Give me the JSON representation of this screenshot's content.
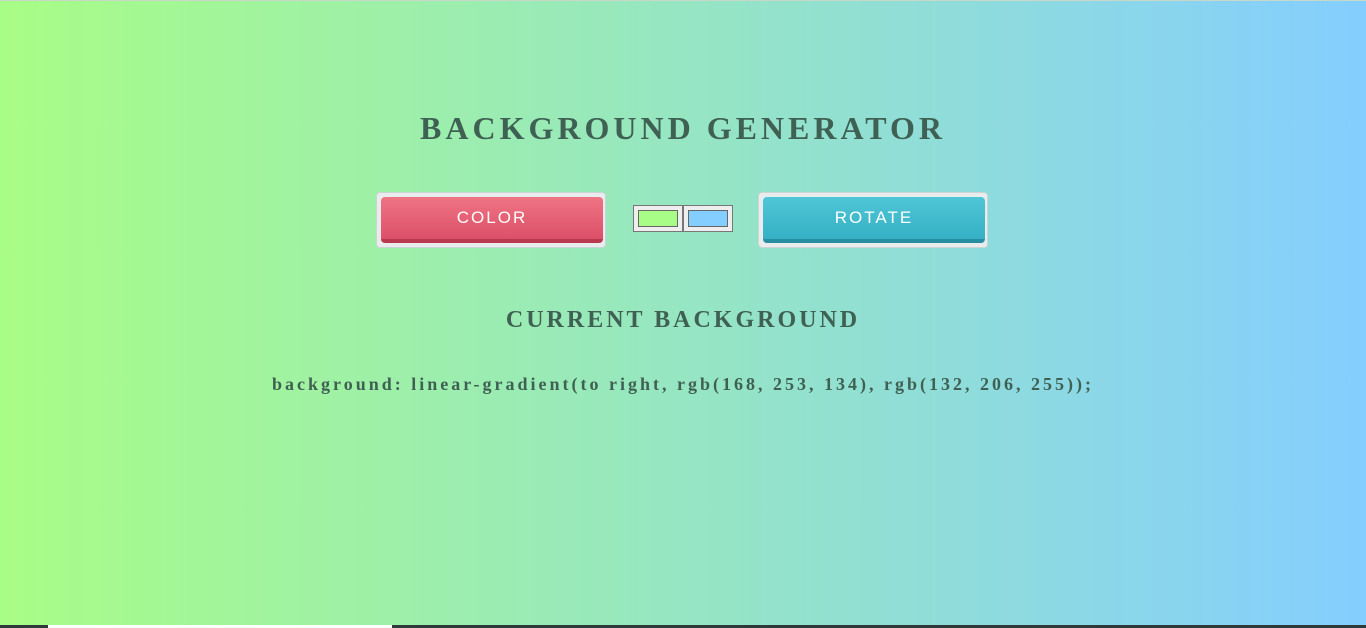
{
  "page": {
    "title": "BACKGROUND GENERATOR",
    "subtitle": "CURRENT BACKGROUND",
    "css_output": "background: linear-gradient(to right, rgb(168, 253, 134), rgb(132, 206, 255));"
  },
  "controls": {
    "color_button_label": "COLOR",
    "rotate_button_label": "ROTATE",
    "color1": "#a8fd86",
    "color2": "#84ceff"
  },
  "colors": {
    "heading": "#3f6153",
    "color_button": "#e85d74",
    "rotate_button": "#3fbacc",
    "gradient_start": "#a8fd86",
    "gradient_end": "#84ceff"
  }
}
